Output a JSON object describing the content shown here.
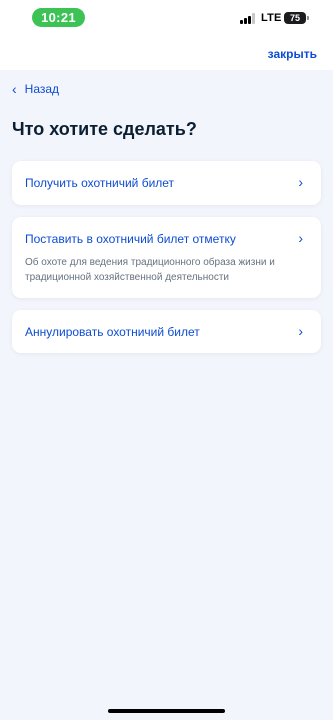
{
  "status_bar": {
    "time": "10:21",
    "network": "LTE",
    "battery": "75"
  },
  "header": {
    "close_label": "закрыть"
  },
  "nav": {
    "back_label": "Назад"
  },
  "page": {
    "title": "Что хотите сделать?"
  },
  "options": [
    {
      "title": "Получить охотничий билет",
      "description": ""
    },
    {
      "title": "Поставить в охотничий билет отметку",
      "description": "Об охоте для ведения традиционного образа жизни и традиционной хозяйственной деятельности"
    },
    {
      "title": "Аннулировать охотничий билет",
      "description": ""
    }
  ],
  "icons": {
    "back": "chevron-left-icon",
    "option": "chevron-right-icon"
  },
  "colors": {
    "accent": "#0d4cd3",
    "background": "#f2f5fb",
    "time_pill": "#3cc255",
    "title": "#0b1f33",
    "muted": "#66727f"
  }
}
